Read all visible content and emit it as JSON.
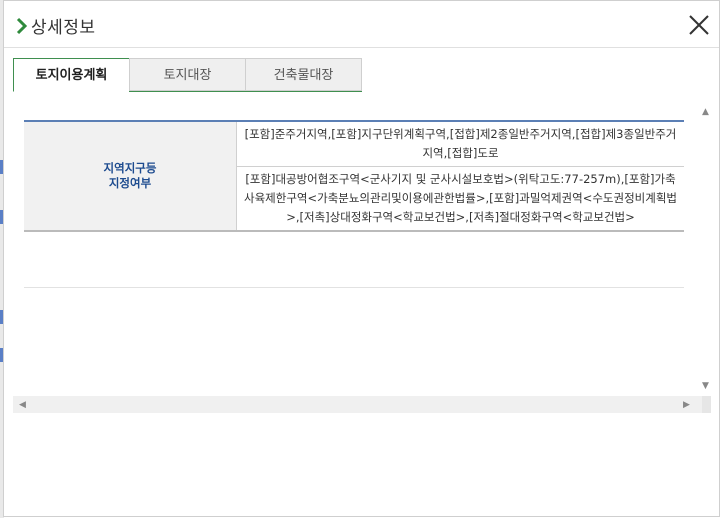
{
  "dialog": {
    "title": "상세정보",
    "close_label": "닫기"
  },
  "tabs": [
    {
      "label": "토지이용계획",
      "active": true
    },
    {
      "label": "토지대장",
      "active": false
    },
    {
      "label": "건축물대장",
      "active": false
    }
  ],
  "table": {
    "header_line1": "지역지구등",
    "header_line2": "지정여부",
    "row1": "[포함]준주거지역,[포함]지구단위계획구역,[접합]제2종일반주거지역,[접합]제3종일반주거지역,[접합]도로",
    "row2": "[포함]대공방어협조구역<군사기지 및 군사시설보호법>(위탁고도:77-257m),[포함]가축사육제한구역<가축분뇨의관리및이용에관한법률>,[포함]과밀억제권역<수도권정비계획법>,[저촉]상대정화구역<학교보건법>,[저촉]절대정화구역<학교보건법>"
  },
  "scrollbars": {
    "up_arrow": "▲",
    "down_arrow": "▼",
    "left_arrow": "◀",
    "right_arrow": "▶"
  },
  "colors": {
    "tab_accent": "#3f8f4f",
    "header_text": "#1d4b8f",
    "chevron": "#2f8a3c"
  }
}
